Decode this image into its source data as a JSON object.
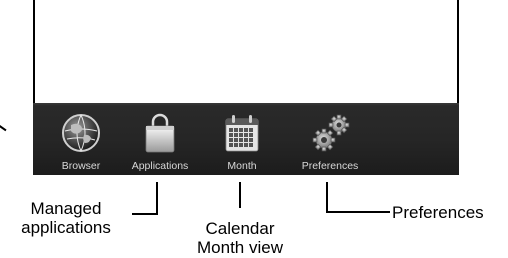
{
  "dock": {
    "items": [
      {
        "label": "Browser",
        "icon": "globe-icon"
      },
      {
        "label": "Applications",
        "icon": "shopping-bag-icon"
      },
      {
        "label": "Month",
        "icon": "calendar-icon"
      },
      {
        "label": "Preferences",
        "icon": "gears-icon"
      }
    ]
  },
  "callouts": {
    "managed": "Managed\napplications",
    "calendar": "Calendar\nMonth view",
    "preferences": "Preferences"
  }
}
